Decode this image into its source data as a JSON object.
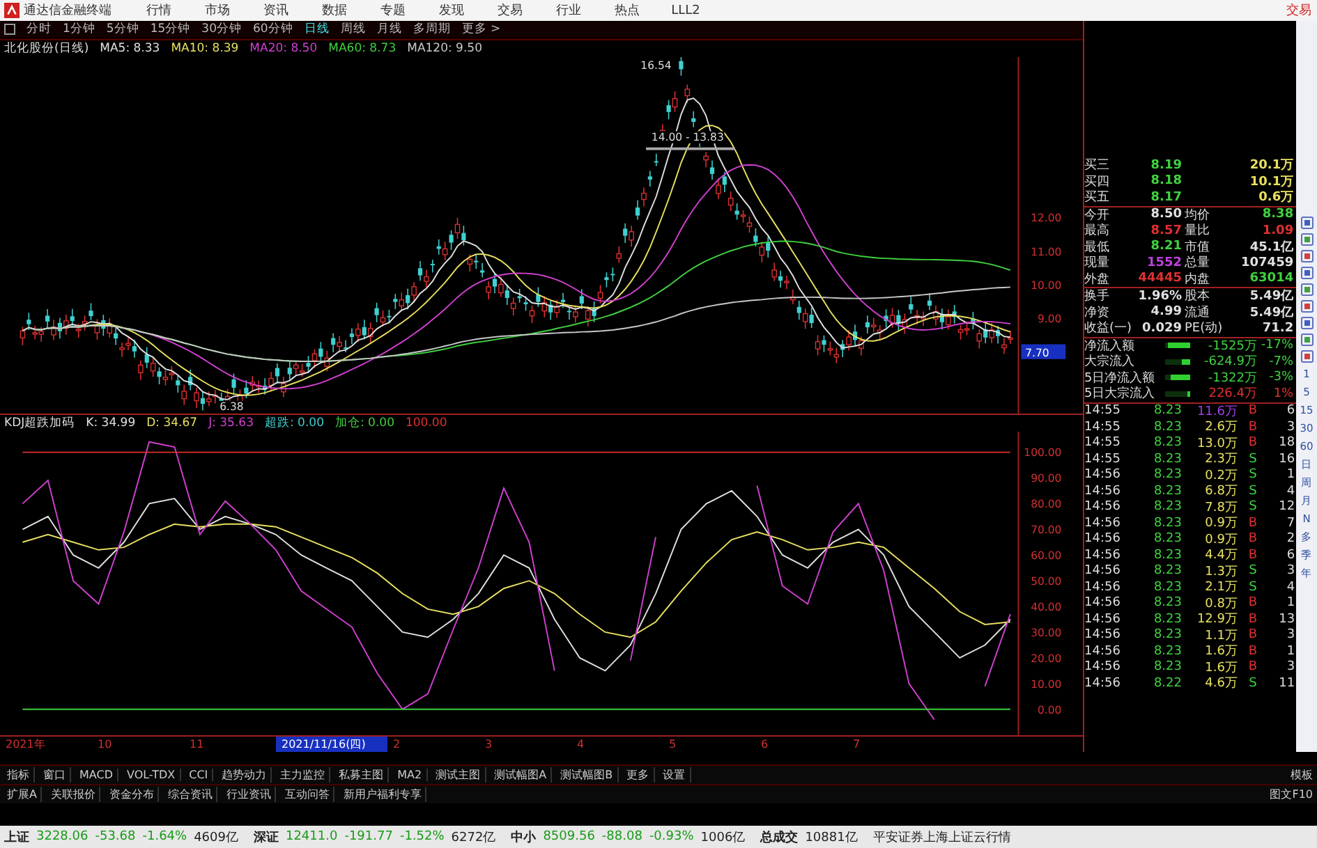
{
  "menu": {
    "app_title": "通达信金融终端",
    "items": [
      "行情",
      "市场",
      "资讯",
      "数据",
      "专题",
      "发现",
      "交易",
      "行业",
      "热点",
      "LLL2"
    ],
    "right": "交易"
  },
  "periods": [
    {
      "label": "分时",
      "selected": false
    },
    {
      "label": "1分钟",
      "selected": false
    },
    {
      "label": "5分钟",
      "selected": false
    },
    {
      "label": "15分钟",
      "selected": false
    },
    {
      "label": "30分钟",
      "selected": false
    },
    {
      "label": "60分钟",
      "selected": false
    },
    {
      "label": "日线",
      "selected": true
    },
    {
      "label": "周线",
      "selected": false
    },
    {
      "label": "月线",
      "selected": false
    },
    {
      "label": "多周期",
      "selected": false
    },
    {
      "label": "更多 >",
      "selected": false
    }
  ],
  "ma_legend": {
    "stock": "北化股份(日线)",
    "items": [
      {
        "text": "MA5: 8.33",
        "color": "#e0e0e0"
      },
      {
        "text": "MA10: 8.39",
        "color": "#e8e060"
      },
      {
        "text": "MA20: 8.50",
        "color": "#d040d0"
      },
      {
        "text": "MA60: 8.73",
        "color": "#40d040"
      },
      {
        "text": "MA120: 9.50",
        "color": "#c8c8c8"
      }
    ]
  },
  "price_chart": {
    "axis": [
      "12.00",
      "11.00",
      "10.00",
      "9.00"
    ],
    "current": "7.70",
    "high": "16.54",
    "mark": "14.00 - 13.83",
    "low": "6.38"
  },
  "kdj_legend": {
    "name": "KDJ超跌加码",
    "items": [
      {
        "text": "超跌: 0.00",
        "color": "#40d0d0"
      }
    ]
  },
  "kdj_chart": {
    "chart_data": {
      "type": "line",
      "ylim": [
        -10,
        108
      ],
      "yticks": [
        {
          "value": 100,
          "label": "100.00"
        },
        {
          "value": 90,
          "label": "90.00"
        },
        {
          "value": 80,
          "label": "80.00"
        },
        {
          "value": 70,
          "label": "70.00"
        },
        {
          "value": 60,
          "label": "60.00"
        },
        {
          "value": 50,
          "label": "50.00"
        },
        {
          "value": 40,
          "label": "40.00"
        },
        {
          "value": 30,
          "label": "30.00"
        },
        {
          "value": 20,
          "label": "20.00"
        },
        {
          "value": 10,
          "label": "10.00"
        },
        {
          "value": 0,
          "label": "0.00"
        }
      ],
      "series": [
        {
          "name": "K: 34.99",
          "color": "#e0e0e0",
          "values": [
            70,
            75,
            60,
            55,
            65,
            80,
            82,
            70,
            75,
            72,
            68,
            60,
            55,
            50,
            40,
            30,
            28,
            35,
            45,
            60,
            55,
            35,
            20,
            15,
            25,
            45,
            70,
            80,
            85,
            75,
            60,
            55,
            65,
            70,
            60,
            40,
            30,
            20,
            25,
            35
          ]
        },
        {
          "name": "D: 34.67",
          "color": "#e8e060",
          "values": [
            65,
            68,
            65,
            62,
            63,
            68,
            72,
            71,
            72,
            72,
            71,
            67,
            63,
            59,
            53,
            45,
            39,
            37,
            40,
            47,
            50,
            45,
            37,
            30,
            28,
            34,
            46,
            57,
            66,
            69,
            66,
            62,
            63,
            65,
            63,
            55,
            47,
            38,
            33,
            34
          ]
        },
        {
          "name": "J: 35.63",
          "color": "#d040d0",
          "values": [
            80,
            89,
            50,
            41,
            69,
            104,
            102,
            68,
            81,
            72,
            62,
            46,
            39,
            32,
            14,
            0,
            6,
            31,
            55,
            86,
            65,
            15,
            null,
            null,
            19,
            67,
            null,
            null,
            null,
            87,
            48,
            41,
            69,
            80,
            54,
            10,
            -4,
            null,
            9,
            37
          ]
        },
        {
          "name": "加仓: 0.00",
          "color": "#40d040",
          "values": [
            0,
            0,
            0,
            0,
            0,
            0,
            0,
            0,
            0,
            0,
            0,
            0,
            0,
            0,
            0,
            0,
            0,
            0,
            0,
            0,
            0,
            0,
            0,
            0,
            0,
            0,
            0,
            0,
            0,
            0,
            0,
            0,
            0,
            0,
            0,
            0,
            0,
            0,
            0,
            0
          ]
        },
        {
          "name": "100.00",
          "color": "#e03030",
          "values": [
            100,
            100,
            100,
            100,
            100,
            100,
            100,
            100,
            100,
            100,
            100,
            100,
            100,
            100,
            100,
            100,
            100,
            100,
            100,
            100,
            100,
            100,
            100,
            100,
            100,
            100,
            100,
            100,
            100,
            100,
            100,
            100,
            100,
            100,
            100,
            100,
            100,
            100,
            100,
            100
          ]
        }
      ]
    }
  },
  "dates": [
    {
      "text": "2021年",
      "selected": false
    },
    {
      "text": "10",
      "selected": false
    },
    {
      "text": "11",
      "selected": false
    },
    {
      "text": "2021/11/16(四)",
      "selected": true
    },
    {
      "text": "2",
      "selected": false
    },
    {
      "text": "3",
      "selected": false
    },
    {
      "text": "4",
      "selected": false
    },
    {
      "text": "5",
      "selected": false
    },
    {
      "text": "6",
      "selected": false
    },
    {
      "text": "7",
      "selected": false
    }
  ],
  "quotes": [
    {
      "label": "买三",
      "value": "8.19",
      "amount": "20.1万"
    },
    {
      "label": "买四",
      "value": "8.18",
      "amount": "10.1万"
    },
    {
      "label": "买五",
      "value": "8.17",
      "amount": "0.6万"
    }
  ],
  "stats": [
    {
      "label": "今开",
      "value": "8.50",
      "color": "#e0e0e0"
    },
    {
      "label": "均价",
      "value": "8.38",
      "color": "#40d040"
    },
    {
      "label": "最高",
      "value": "8.57",
      "color": "#e03030"
    },
    {
      "label": "量比",
      "value": "1.09",
      "color": "#e03030"
    },
    {
      "label": "最低",
      "value": "8.21",
      "color": "#40d040"
    },
    {
      "label": "市值",
      "value": "45.1亿",
      "color": "#e0e0e0"
    },
    {
      "label": "现量",
      "value": "1552",
      "color": "#c040e0"
    },
    {
      "label": "总量",
      "value": "107459",
      "color": "#e0e0e0"
    },
    {
      "label": "外盘",
      "value": "44445",
      "color": "#e03030"
    },
    {
      "label": "内盘",
      "value": "63014",
      "color": "#40d040"
    },
    {
      "label": "换手",
      "value": "1.96%",
      "color": "#e0e0e0"
    },
    {
      "label": "股本",
      "value": "5.49亿",
      "color": "#e0e0e0"
    },
    {
      "label": "净资",
      "value": "4.99",
      "color": "#e0e0e0"
    },
    {
      "label": "流通",
      "value": "5.49亿",
      "color": "#e0e0e0"
    },
    {
      "label": "收益(一)",
      "value": "0.029",
      "color": "#e0e0e0"
    },
    {
      "label": "PE(动)",
      "value": "71.2",
      "color": "#e0e0e0"
    }
  ],
  "flows": [
    {
      "label": "净流入额",
      "level": 0.9,
      "amount": "-1525万",
      "pct": "-17%",
      "color": "#40d040"
    },
    {
      "label": "大宗流入",
      "level": 0.35,
      "amount": "-624.9万",
      "pct": "-7%",
      "color": "#40d040"
    },
    {
      "label": "5日净流入额",
      "level": 0.8,
      "amount": "-1322万",
      "pct": "-3%",
      "color": "#40d040"
    },
    {
      "label": "5日大宗流入",
      "level": 0.1,
      "amount": "226.4万",
      "pct": "1%",
      "color": "#e03030"
    }
  ],
  "ticks": [
    {
      "time": "14:55",
      "price": "8.23",
      "volume": "11.6万",
      "large": true,
      "bs": "B",
      "color": "#e03030",
      "count": "6"
    },
    {
      "time": "14:55",
      "price": "8.23",
      "volume": "2.6万",
      "large": false,
      "bs": "B",
      "color": "#e03030",
      "count": "3"
    },
    {
      "time": "14:55",
      "price": "8.23",
      "volume": "13.0万",
      "large": false,
      "bs": "B",
      "color": "#e03030",
      "count": "18"
    },
    {
      "time": "14:55",
      "price": "8.23",
      "volume": "2.3万",
      "large": false,
      "bs": "S",
      "color": "#40d040",
      "count": "16"
    },
    {
      "time": "14:56",
      "price": "8.23",
      "volume": "0.2万",
      "large": false,
      "bs": "S",
      "color": "#40d040",
      "count": "1"
    },
    {
      "time": "14:56",
      "price": "8.23",
      "volume": "6.8万",
      "large": false,
      "bs": "S",
      "color": "#40d040",
      "count": "4"
    },
    {
      "time": "14:56",
      "price": "8.23",
      "volume": "7.8万",
      "large": false,
      "bs": "S",
      "color": "#40d040",
      "count": "12"
    },
    {
      "time": "14:56",
      "price": "8.23",
      "volume": "0.9万",
      "large": false,
      "bs": "B",
      "color": "#e03030",
      "count": "7"
    },
    {
      "time": "14:56",
      "price": "8.23",
      "volume": "0.9万",
      "large": false,
      "bs": "B",
      "color": "#e03030",
      "count": "2"
    },
    {
      "time": "14:56",
      "price": "8.23",
      "volume": "4.4万",
      "large": false,
      "bs": "B",
      "color": "#e03030",
      "count": "6"
    },
    {
      "time": "14:56",
      "price": "8.23",
      "volume": "1.3万",
      "large": false,
      "bs": "S",
      "color": "#40d040",
      "count": "3"
    },
    {
      "time": "14:56",
      "price": "8.23",
      "volume": "2.1万",
      "large": false,
      "bs": "S",
      "color": "#40d040",
      "count": "4"
    },
    {
      "time": "14:56",
      "price": "8.23",
      "volume": "0.8万",
      "large": false,
      "bs": "B",
      "color": "#e03030",
      "count": "1"
    },
    {
      "time": "14:56",
      "price": "8.23",
      "volume": "12.9万",
      "large": false,
      "bs": "B",
      "color": "#e03030",
      "count": "13"
    },
    {
      "time": "14:56",
      "price": "8.23",
      "volume": "1.1万",
      "large": false,
      "bs": "B",
      "color": "#e03030",
      "count": "3"
    },
    {
      "time": "14:56",
      "price": "8.23",
      "volume": "1.6万",
      "large": false,
      "bs": "B",
      "color": "#e03030",
      "count": "1"
    },
    {
      "time": "14:56",
      "price": "8.23",
      "volume": "1.6万",
      "large": false,
      "bs": "B",
      "color": "#e03030",
      "count": "3"
    },
    {
      "time": "14:56",
      "price": "8.22",
      "volume": "4.6万",
      "large": false,
      "bs": "S",
      "color": "#40d040",
      "count": "11"
    }
  ],
  "side_strip": [
    "1",
    "5",
    "15",
    "30",
    "60",
    "日",
    "周",
    "月",
    "N",
    "多",
    "季",
    "年"
  ],
  "indicator_tabs": [
    "指标",
    "窗口",
    "MACD",
    "VOL-TDX",
    "CCI",
    "趋势动力",
    "主力监控",
    "私募主图",
    "MA2",
    "测试主图",
    "测试幅图A",
    "测试幅图B",
    "更多",
    "设置"
  ],
  "indicator_right": "模板",
  "info_tabs": [
    "扩展A",
    "关联报价",
    "资金分布",
    "综合资讯",
    "行业资讯",
    "互动问答",
    "新用户福利专享"
  ],
  "info_right": "图文F10",
  "status": [
    {
      "name": "上证",
      "index": "3228.06",
      "change": "-53.68",
      "pct": "-1.64%",
      "amount": "4609亿",
      "color": "#1a9a1a"
    },
    {
      "name": "深证",
      "index": "12411.0",
      "change": "-191.77",
      "pct": "-1.52%",
      "amount": "6272亿",
      "color": "#1a9a1a"
    },
    {
      "name": "中小",
      "index": "8509.56",
      "change": "-88.08",
      "pct": "-0.93%",
      "amount": "1006亿",
      "color": "#1a9a1a"
    }
  ],
  "total": {
    "label": "总成交",
    "value": "10881亿",
    "source": "平安证券上海上证云行情"
  }
}
